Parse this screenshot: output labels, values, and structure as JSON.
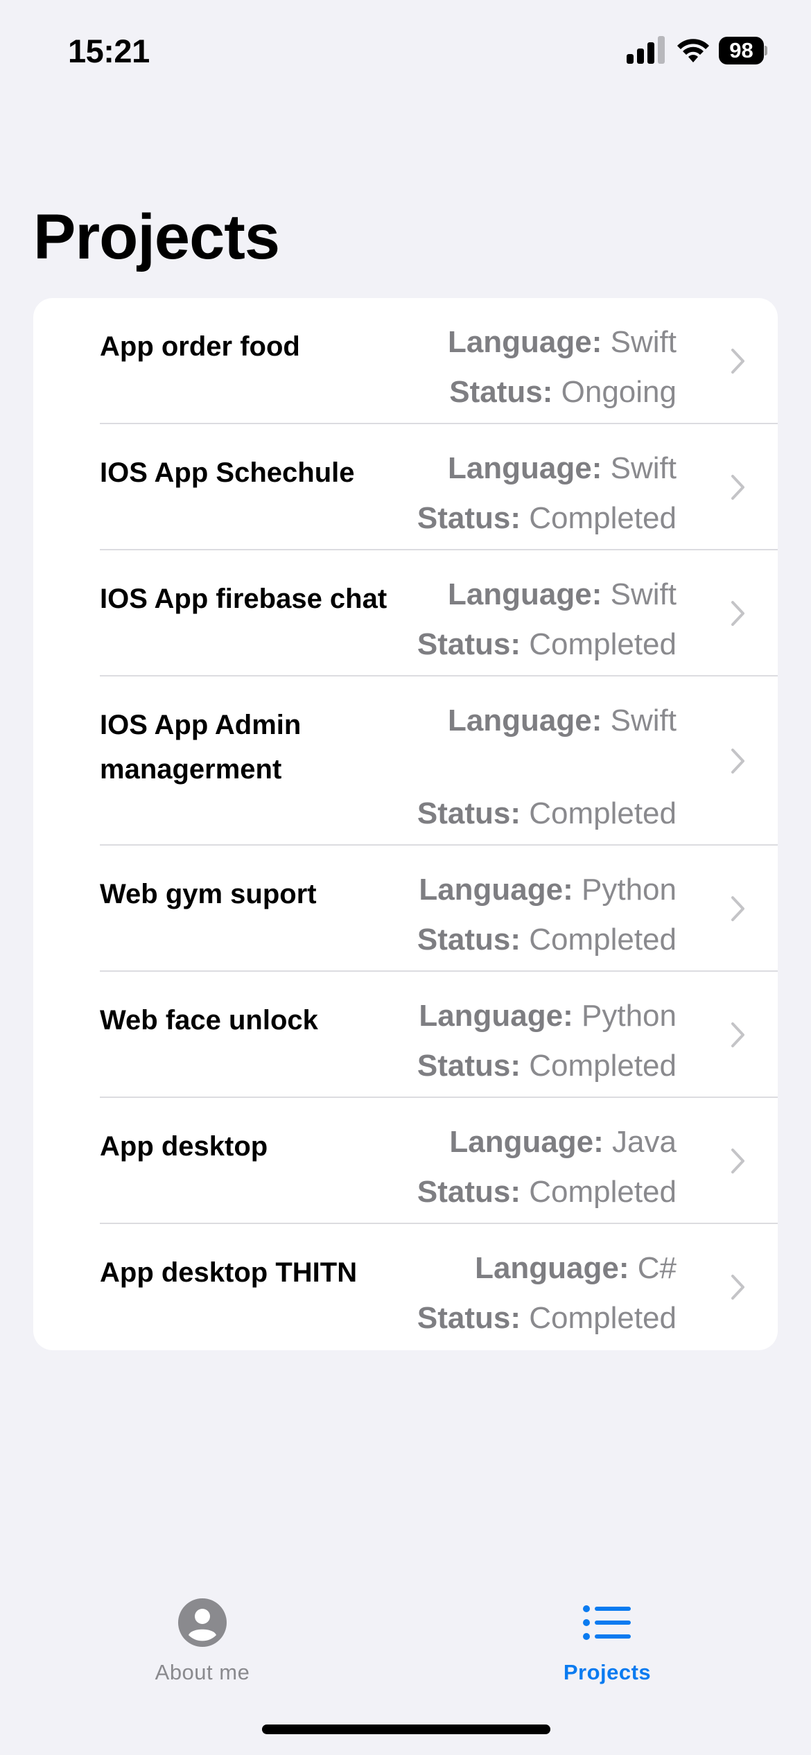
{
  "status_bar": {
    "time": "15:21",
    "battery": "98",
    "signal_icon": "cellular-signal-icon",
    "wifi_icon": "wifi-icon"
  },
  "page_title": "Projects",
  "labels": {
    "language": "Language:",
    "status": "Status:"
  },
  "projects": [
    {
      "title": "App order food",
      "language": "Swift",
      "status": "Ongoing"
    },
    {
      "title": "IOS App Schechule",
      "language": "Swift",
      "status": "Completed"
    },
    {
      "title": "IOS App firebase chat",
      "language": "Swift",
      "status": "Completed"
    },
    {
      "title": "IOS App Admin managerment",
      "language": "Swift",
      "status": "Completed"
    },
    {
      "title": "Web gym suport",
      "language": "Python",
      "status": "Completed"
    },
    {
      "title": "Web face unlock",
      "language": "Python",
      "status": "Completed"
    },
    {
      "title": "App desktop",
      "language": "Java",
      "status": "Completed"
    },
    {
      "title": "App desktop THITN",
      "language": "C#",
      "status": "Completed"
    }
  ],
  "tabbar": {
    "about_label": "About me",
    "projects_label": "Projects",
    "about_icon": "person-circle-icon",
    "projects_icon": "list-bullet-icon",
    "active_tab": "Projects",
    "active_color": "#0a7bf0",
    "inactive_color": "#8a8a8e"
  }
}
